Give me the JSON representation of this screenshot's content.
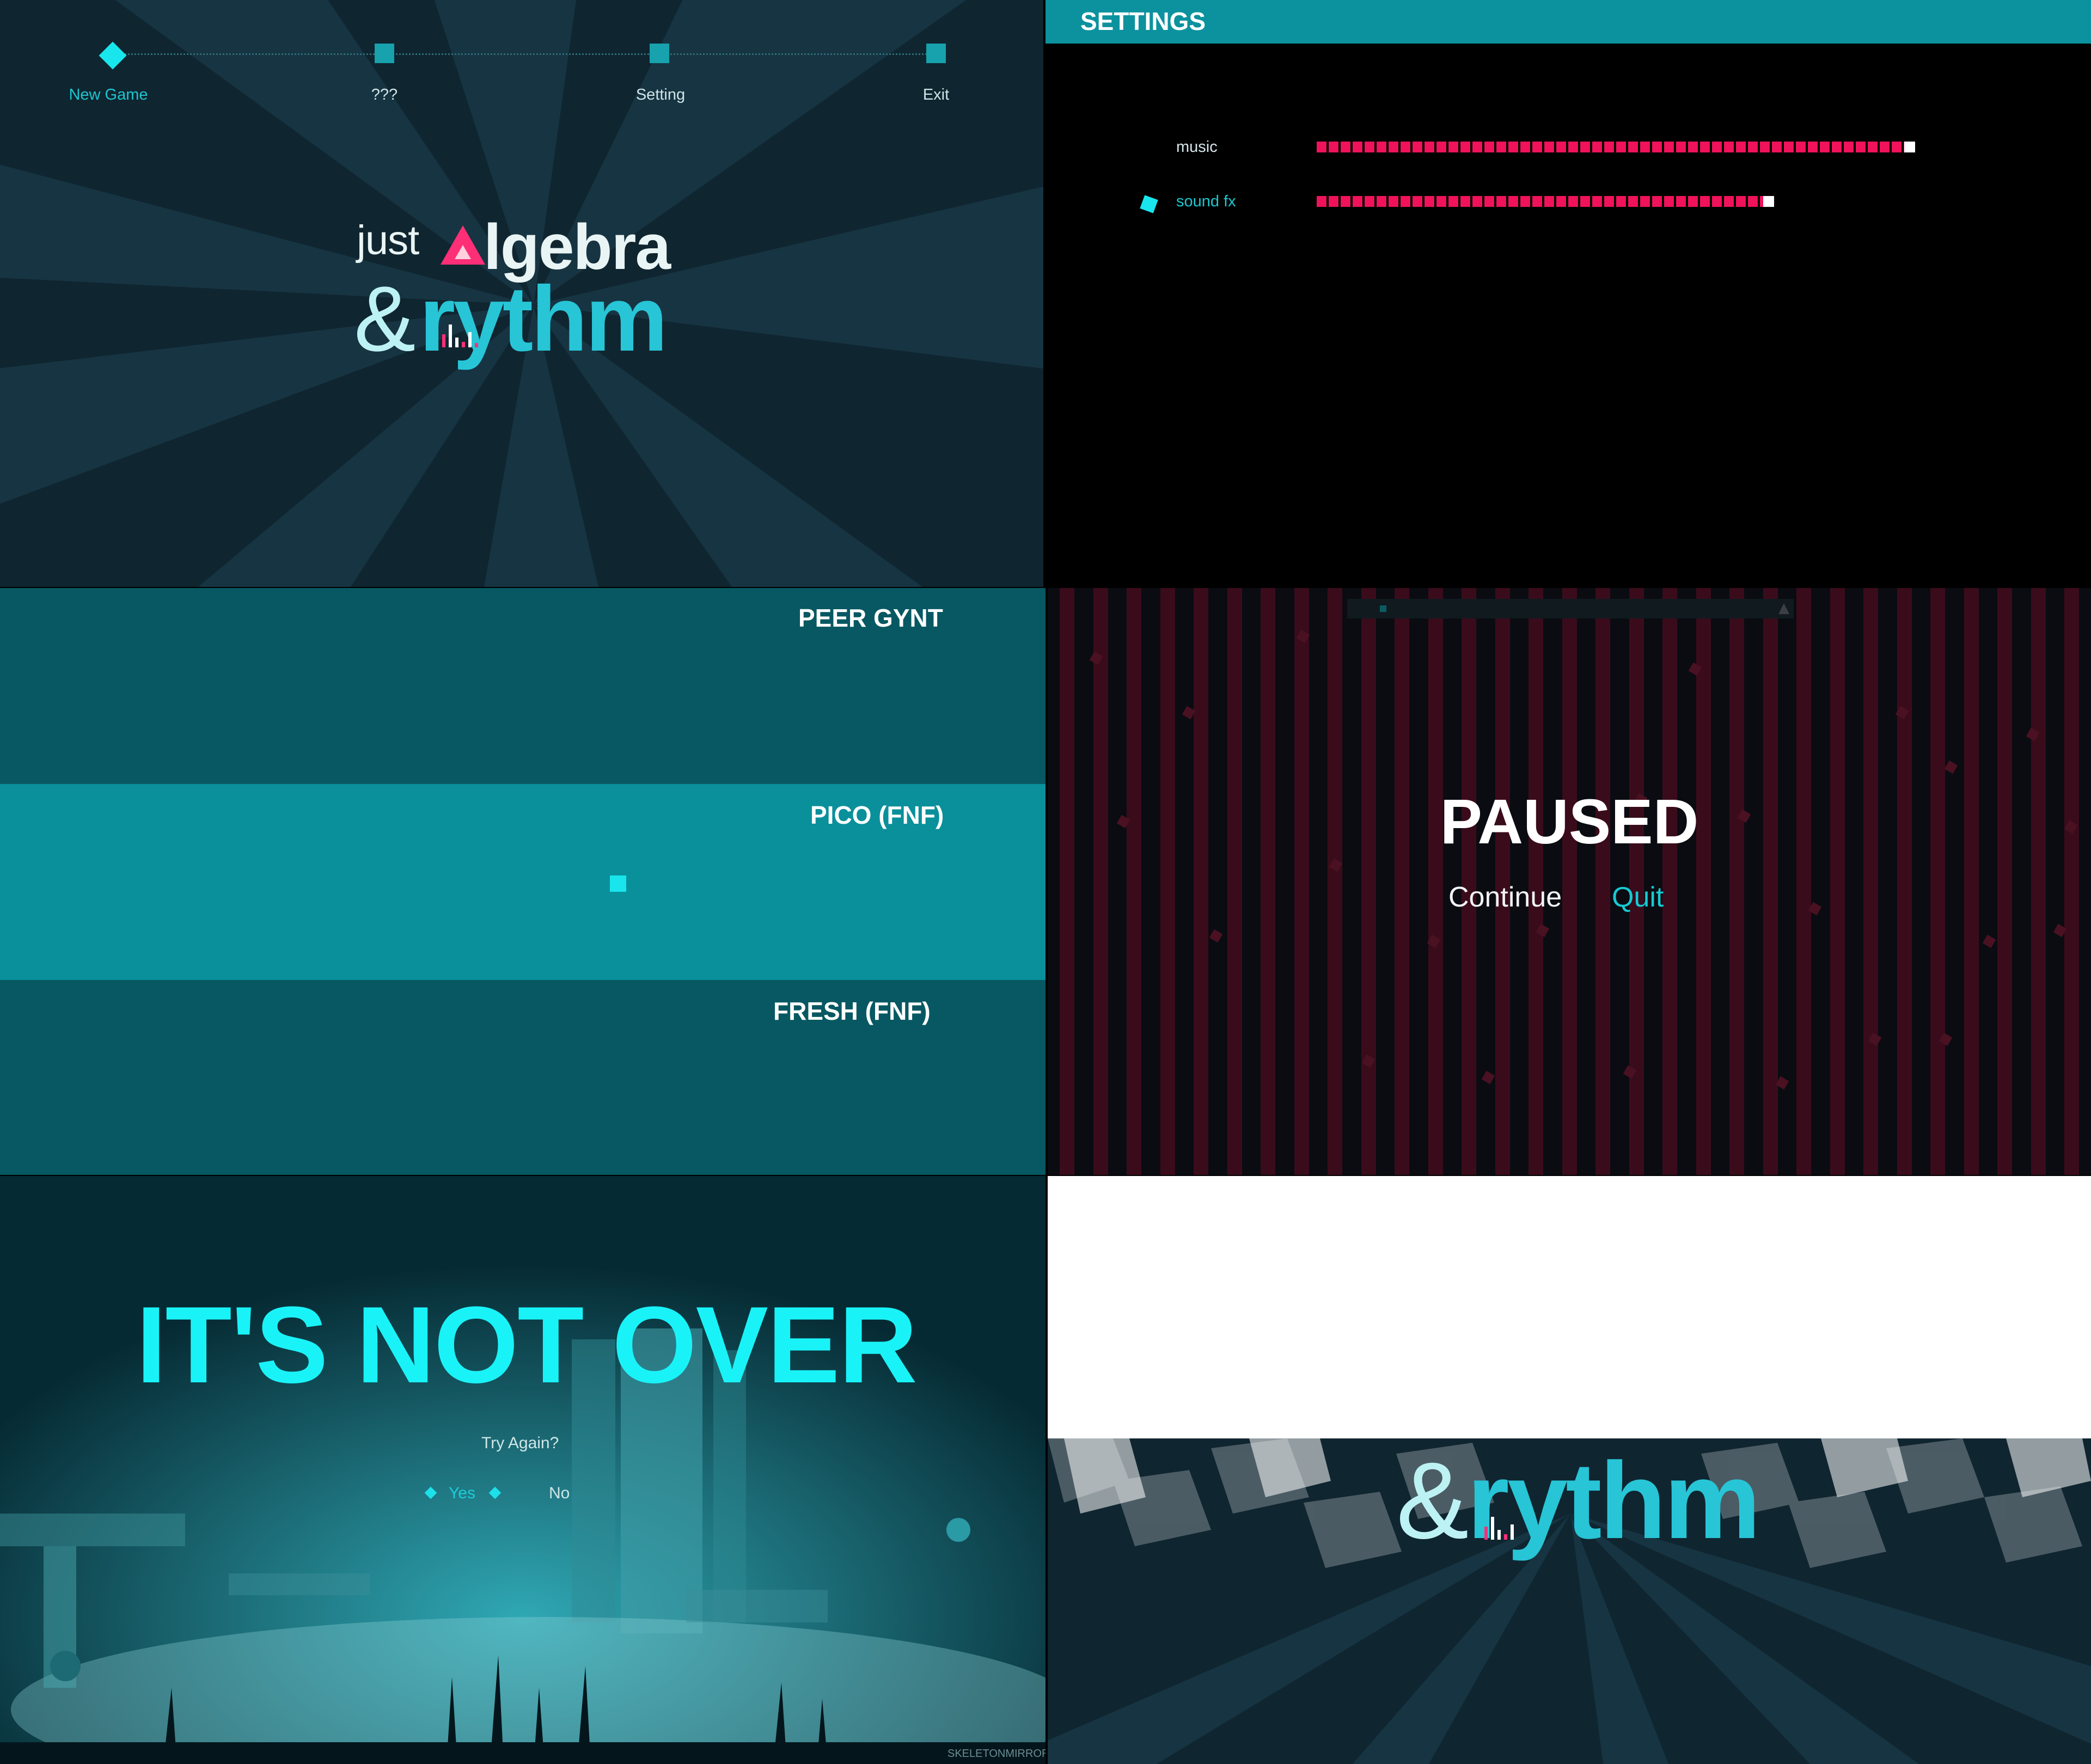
{
  "main_menu": {
    "items": [
      "New Game",
      "???",
      "Setting",
      "Exit"
    ],
    "selected_index": 0,
    "logo": {
      "word_just": "just",
      "word_algebra": "lgebra",
      "word_amp": "&",
      "word_rythm": "rythm"
    }
  },
  "settings": {
    "title": "SETTINGS",
    "options": [
      {
        "label": "music",
        "level": 1.0
      },
      {
        "label": "sound fx",
        "level": 0.76
      }
    ],
    "selected_index": 1
  },
  "song_select": {
    "songs": [
      "PEER GYNT",
      "PICO (FNF)",
      "FRESH (FNF)"
    ],
    "selected_index": 1
  },
  "pause_menu": {
    "title": "PAUSED",
    "options": [
      "Continue",
      "Quit"
    ],
    "selected_index": 1
  },
  "game_over": {
    "title": "IT'S NOT OVER",
    "prompt": "Try Again?",
    "options": [
      "Yes",
      "No"
    ],
    "selected_index": 0,
    "signature": "SKELETONMIRRORS"
  },
  "transition": {
    "logo": {
      "word_amp": "&",
      "word_rythm": "rythm"
    }
  },
  "colors": {
    "accent_cyan": "#18e6ec",
    "teal_bar": "#0b929e",
    "slider_pink": "#f0125a",
    "song_row_dark": "#075862",
    "song_row_selected": "#0a909b",
    "pause_stripe": "#3a0c1b"
  }
}
